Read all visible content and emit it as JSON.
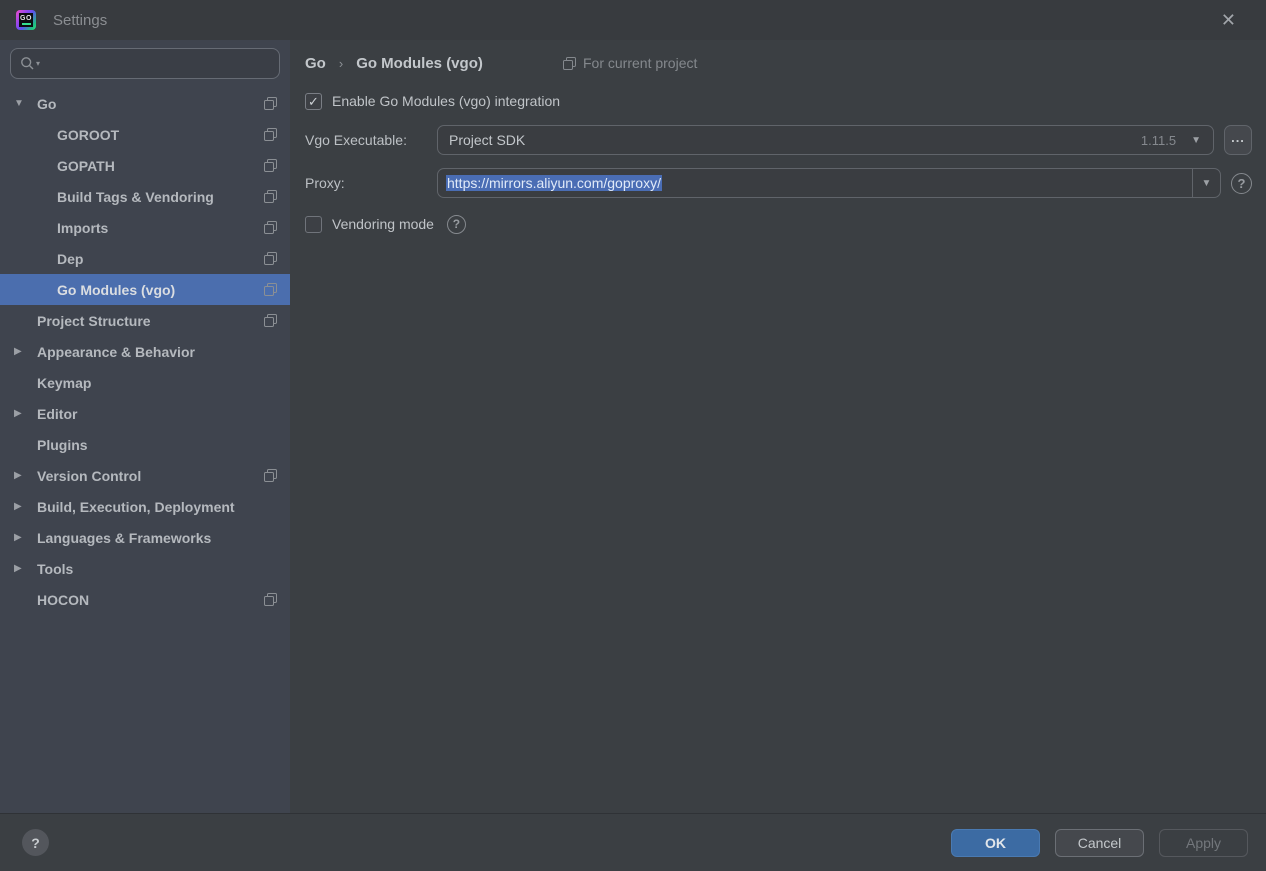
{
  "colors": {
    "titlebar_bg": "#383b3f",
    "sidebar_bg": "#3f444e",
    "main_bg": "#3b3f43",
    "selection_blue": "#4b6eae",
    "text_selection_blue": "#4a6db4",
    "ok_button_blue": "#3c6ba3",
    "field_border": "#60646a"
  },
  "icons": {
    "check": "✓",
    "expanded": "▼",
    "collapsed": "▶",
    "dropdown": "▼",
    "search_caret": "▾",
    "close": "✕",
    "help": "?",
    "ellipsis_note": "browse button uses three dots"
  },
  "window": {
    "title": "Settings",
    "logo_text": "GO",
    "close_glyph": "✕"
  },
  "sidebar": {
    "items": [
      {
        "label": "Go",
        "level": 0,
        "arrow": "expanded",
        "per_project": true,
        "selected": false
      },
      {
        "label": "GOROOT",
        "level": 1,
        "arrow": "none",
        "per_project": true,
        "selected": false
      },
      {
        "label": "GOPATH",
        "level": 1,
        "arrow": "none",
        "per_project": true,
        "selected": false
      },
      {
        "label": "Build Tags & Vendoring",
        "level": 1,
        "arrow": "none",
        "per_project": true,
        "selected": false
      },
      {
        "label": "Imports",
        "level": 1,
        "arrow": "none",
        "per_project": true,
        "selected": false
      },
      {
        "label": "Dep",
        "level": 1,
        "arrow": "none",
        "per_project": true,
        "selected": false
      },
      {
        "label": "Go Modules (vgo)",
        "level": 1,
        "arrow": "none",
        "per_project": true,
        "selected": true
      },
      {
        "label": "Project Structure",
        "level": 0,
        "arrow": "none",
        "per_project": true,
        "selected": false
      },
      {
        "label": "Appearance & Behavior",
        "level": 0,
        "arrow": "collapsed",
        "per_project": false,
        "selected": false
      },
      {
        "label": "Keymap",
        "level": 0,
        "arrow": "none",
        "per_project": false,
        "selected": false
      },
      {
        "label": "Editor",
        "level": 0,
        "arrow": "collapsed",
        "per_project": false,
        "selected": false
      },
      {
        "label": "Plugins",
        "level": 0,
        "arrow": "none",
        "per_project": false,
        "selected": false
      },
      {
        "label": "Version Control",
        "level": 0,
        "arrow": "collapsed",
        "per_project": true,
        "selected": false
      },
      {
        "label": "Build, Execution, Deployment",
        "level": 0,
        "arrow": "collapsed",
        "per_project": false,
        "selected": false
      },
      {
        "label": "Languages & Frameworks",
        "level": 0,
        "arrow": "collapsed",
        "per_project": false,
        "selected": false
      },
      {
        "label": "Tools",
        "level": 0,
        "arrow": "collapsed",
        "per_project": false,
        "selected": false
      },
      {
        "label": "HOCON",
        "level": 0,
        "arrow": "none",
        "per_project": true,
        "selected": false
      }
    ]
  },
  "main": {
    "breadcrumb": {
      "parent": "Go",
      "separator": "›",
      "current": "Go Modules (vgo)",
      "scope": "For current project"
    },
    "enable_checkbox": {
      "label": "Enable Go Modules (vgo) integration",
      "checked": true
    },
    "vgo_executable": {
      "label": "Vgo Executable:",
      "value": "Project SDK",
      "version": "1.11.5",
      "browse_label": "..."
    },
    "proxy": {
      "label": "Proxy:",
      "value": "https://mirrors.aliyun.com/goproxy/",
      "text_selected": true
    },
    "vendoring": {
      "label": "Vendoring mode",
      "checked": false
    }
  },
  "footer": {
    "help_glyph": "?",
    "ok": "OK",
    "cancel": "Cancel",
    "apply": "Apply"
  }
}
